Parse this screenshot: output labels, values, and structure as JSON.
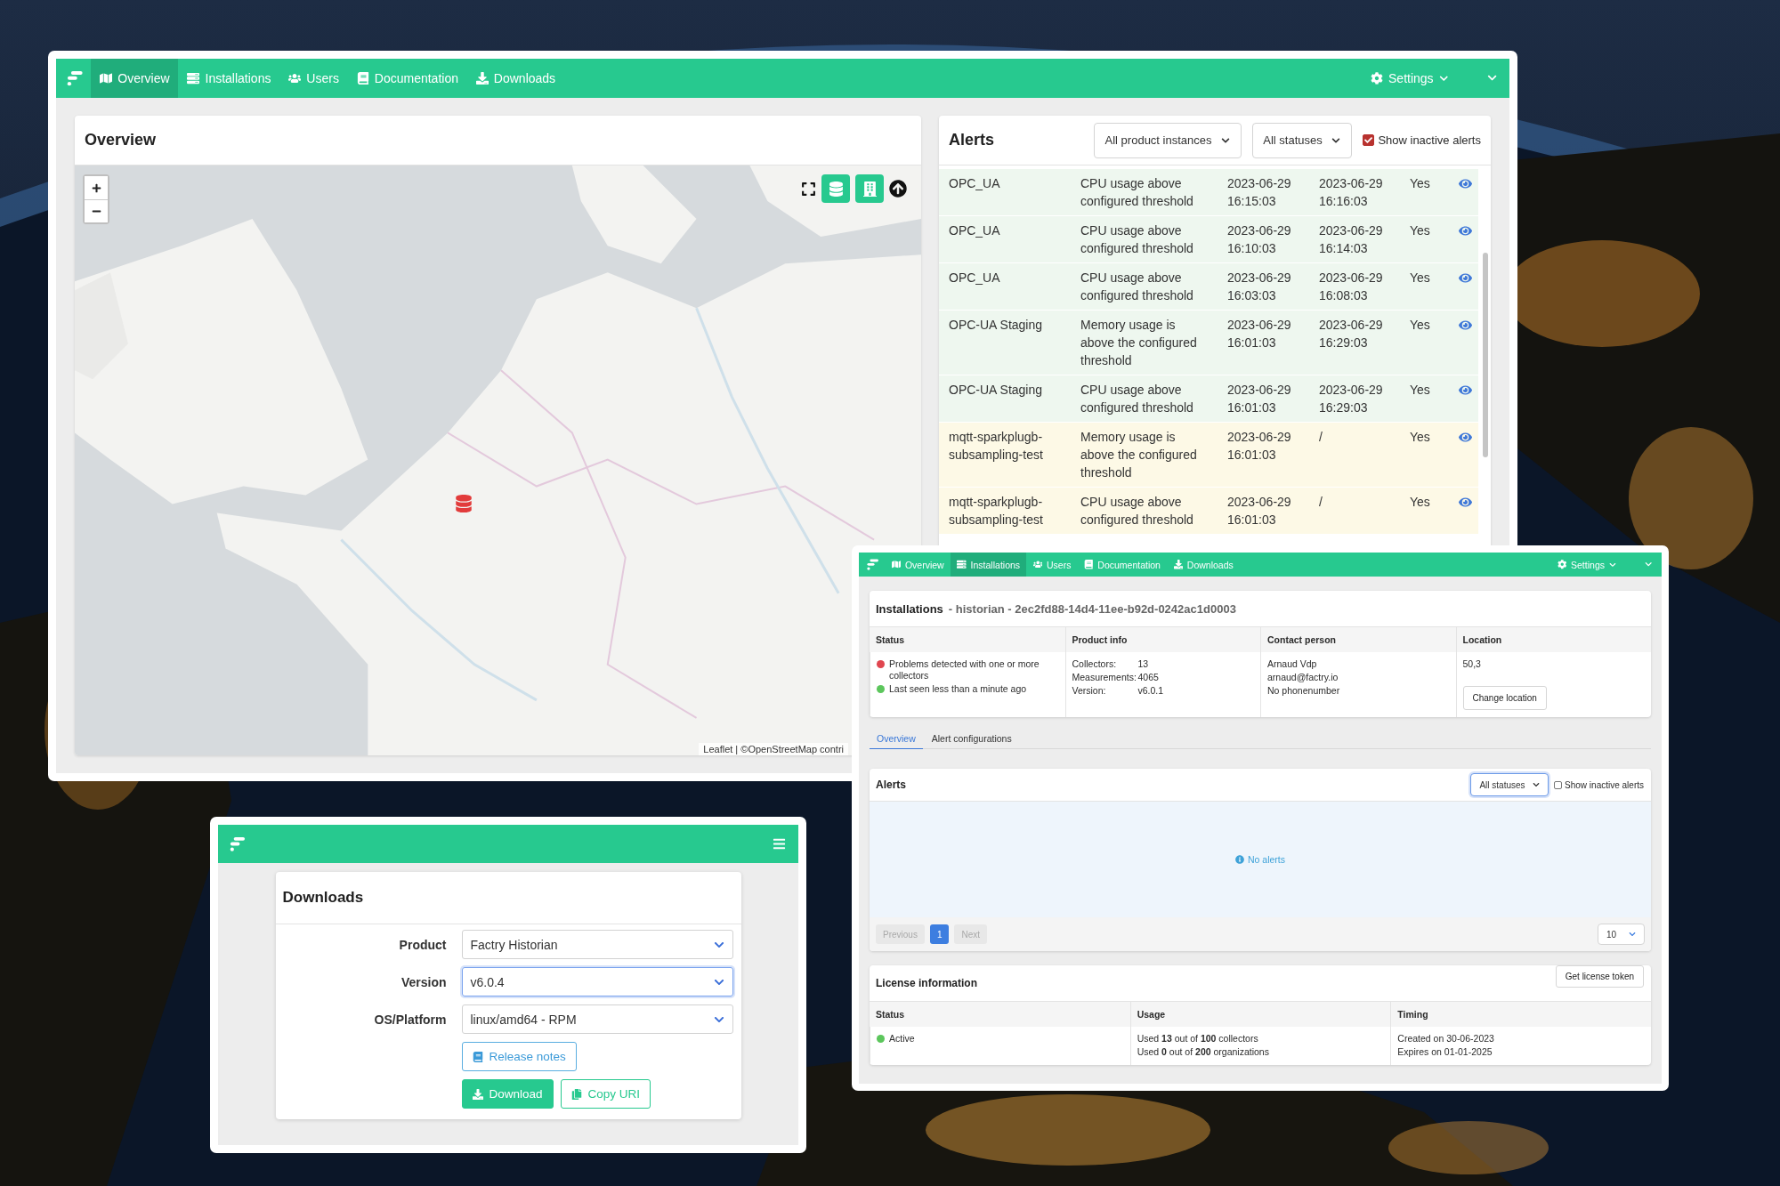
{
  "overview_window": {
    "nav": {
      "items": [
        {
          "label": "Overview",
          "selected": true
        },
        {
          "label": "Installations",
          "selected": false
        },
        {
          "label": "Users",
          "selected": false
        },
        {
          "label": "Documentation",
          "selected": false
        },
        {
          "label": "Downloads",
          "selected": false
        }
      ],
      "settings": "Settings"
    },
    "overview_card": {
      "title": "Overview",
      "map_attribution": "Leaflet | ©OpenStreetMap contri"
    },
    "alerts_card": {
      "title": "Alerts",
      "filters": [
        "All product instances",
        "All statuses"
      ],
      "show_inactive": {
        "label": "Show inactive alerts",
        "checked": true
      },
      "rows": [
        {
          "instance": "OPC_UA",
          "message": "CPU usage above configured threshold",
          "start": "2023-06-29 16:15:03",
          "end": "2023-06-29 16:16:03",
          "column_5": "Yes",
          "resolved": true
        },
        {
          "instance": "OPC_UA",
          "message": "CPU usage above configured threshold",
          "start": "2023-06-29 16:10:03",
          "end": "2023-06-29 16:14:03",
          "column_5": "Yes",
          "resolved": true
        },
        {
          "instance": "OPC_UA",
          "message": "CPU usage above configured threshold",
          "start": "2023-06-29 16:03:03",
          "end": "2023-06-29 16:08:03",
          "column_5": "Yes",
          "resolved": true
        },
        {
          "instance": "OPC-UA Staging",
          "message": "Memory usage is above the configured threshold",
          "start": "2023-06-29 16:01:03",
          "end": "2023-06-29 16:29:03",
          "column_5": "Yes",
          "resolved": true
        },
        {
          "instance": "OPC-UA Staging",
          "message": "CPU usage above configured threshold",
          "start": "2023-06-29 16:01:03",
          "end": "2023-06-29 16:29:03",
          "column_5": "Yes",
          "resolved": true
        },
        {
          "instance": "mqtt-sparkplugb-subsampling-test",
          "message": "Memory usage is above the configured threshold",
          "start": "2023-06-29 16:01:03",
          "end": "/",
          "column_5": "Yes",
          "resolved": false
        },
        {
          "instance": "mqtt-sparkplugb-subsampling-test",
          "message": "CPU usage above configured threshold",
          "start": "2023-06-29 16:01:03",
          "end": "/",
          "column_5": "Yes",
          "resolved": false
        }
      ]
    }
  },
  "installation_window": {
    "nav": {
      "items": [
        {
          "label": "Overview",
          "selected": false
        },
        {
          "label": "Installations",
          "selected": true
        },
        {
          "label": "Users",
          "selected": false
        },
        {
          "label": "Documentation",
          "selected": false
        },
        {
          "label": "Downloads",
          "selected": false
        }
      ],
      "settings": "Settings"
    },
    "installation_card": {
      "title": "Installations",
      "subtitle": "- historian - 2ec2fd88-14d4-11ee-b92d-0242ac1d0003",
      "columns": [
        "Status",
        "Product info",
        "Contact person",
        "Location"
      ],
      "status": [
        {
          "text": "Problems detected with one or more collectors",
          "color": "#e0464f"
        },
        {
          "text": "Last seen less than a minute ago",
          "color": "#5cc65c"
        }
      ],
      "product_info": [
        {
          "label": "Collectors:",
          "value": "13"
        },
        {
          "label": "Measurements:",
          "value": "4065"
        },
        {
          "label": "Version:",
          "value": "v6.0.1"
        }
      ],
      "contact": [
        "Arnaud Vdp",
        "arnaud@factry.io",
        "No phonenumber"
      ],
      "location": "50,3",
      "location_button": "Change location"
    },
    "tabs": [
      {
        "label": "Overview",
        "selected": true
      },
      {
        "label": "Alert configurations",
        "selected": false
      }
    ],
    "alerts_card": {
      "title": "Alerts",
      "filter": "All statuses",
      "show_inactive": {
        "label": "Show inactive alerts",
        "checked": false
      },
      "empty": "No alerts",
      "pagination": {
        "previous": "Previous",
        "next": "Next",
        "pages": [
          {
            "label": "1",
            "selected": true
          }
        ],
        "page_size": "10"
      }
    },
    "license_card": {
      "title": "License information",
      "button": "Get license token",
      "columns": [
        "Status",
        "Usage",
        "Timing"
      ],
      "status": {
        "text": "Active",
        "color": "#5cc65c"
      },
      "usage": [
        "Used **13** out of **100** collectors",
        "Used **0** out of **200** organizations"
      ],
      "timing": [
        "Created on 30-06-2023",
        "Expires on 01-01-2025"
      ]
    }
  },
  "downloads_window": {
    "title": "Downloads",
    "fields": [
      {
        "label": "Product",
        "value": "Factry Historian",
        "focused": false
      },
      {
        "label": "Version",
        "value": "v6.0.4",
        "focused": true
      },
      {
        "label": "OS/Platform",
        "value": "linux/amd64 - RPM",
        "focused": false
      }
    ],
    "release_notes": "Release notes",
    "download": "Download",
    "copy": "Copy URI"
  }
}
